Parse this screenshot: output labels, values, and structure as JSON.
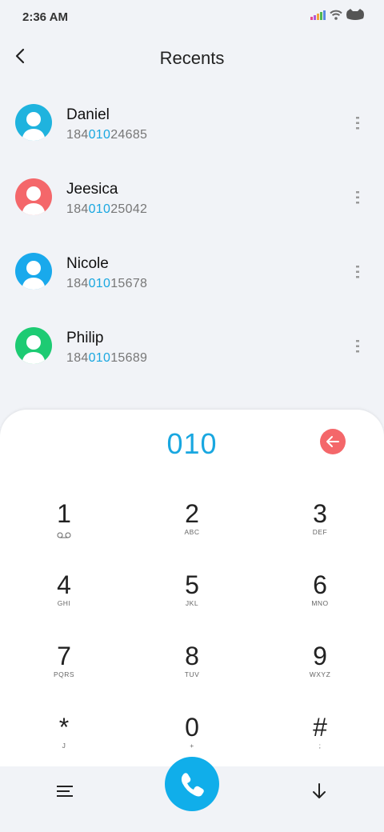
{
  "status_bar": {
    "time": "2:36 AM"
  },
  "header": {
    "title": "Recents"
  },
  "contacts": [
    {
      "name": "Daniel",
      "num_prefix": "184",
      "num_match": "010",
      "num_suffix": "24685",
      "avatar_color": "#1fb3de"
    },
    {
      "name": "Jeesica",
      "num_prefix": "184",
      "num_match": "010",
      "num_suffix": "25042",
      "avatar_color": "#f4676a"
    },
    {
      "name": "Nicole",
      "num_prefix": "184",
      "num_match": "010",
      "num_suffix": "15678",
      "avatar_color": "#19a9ec"
    },
    {
      "name": "Philip",
      "num_prefix": "184",
      "num_match": "010",
      "num_suffix": "15689",
      "avatar_color": "#1dcb73"
    }
  ],
  "dialpad": {
    "input_value": "010",
    "keys": [
      {
        "digit": "1",
        "letters": ""
      },
      {
        "digit": "2",
        "letters": "ABC"
      },
      {
        "digit": "3",
        "letters": "DEF"
      },
      {
        "digit": "4",
        "letters": "GHI"
      },
      {
        "digit": "5",
        "letters": "JKL"
      },
      {
        "digit": "6",
        "letters": "MNO"
      },
      {
        "digit": "7",
        "letters": "PQRS"
      },
      {
        "digit": "8",
        "letters": "TUV"
      },
      {
        "digit": "9",
        "letters": "WXYZ"
      },
      {
        "digit": "*",
        "letters": "J"
      },
      {
        "digit": "0",
        "letters": "+"
      },
      {
        "digit": "#",
        "letters": ";"
      }
    ]
  },
  "colors": {
    "accent": "#19a7e0",
    "delete": "#f4676a",
    "call": "#10aeea"
  },
  "icons": {
    "status": [
      "signal-icon",
      "wifi-icon",
      "battery-icon"
    ],
    "back": "back-arrow-icon",
    "more": "more-vertical-icon",
    "delete": "backspace-icon",
    "voicemail": "voicemail-icon",
    "menu": "menu-icon",
    "call": "phone-icon",
    "collapse": "arrow-down-icon"
  }
}
